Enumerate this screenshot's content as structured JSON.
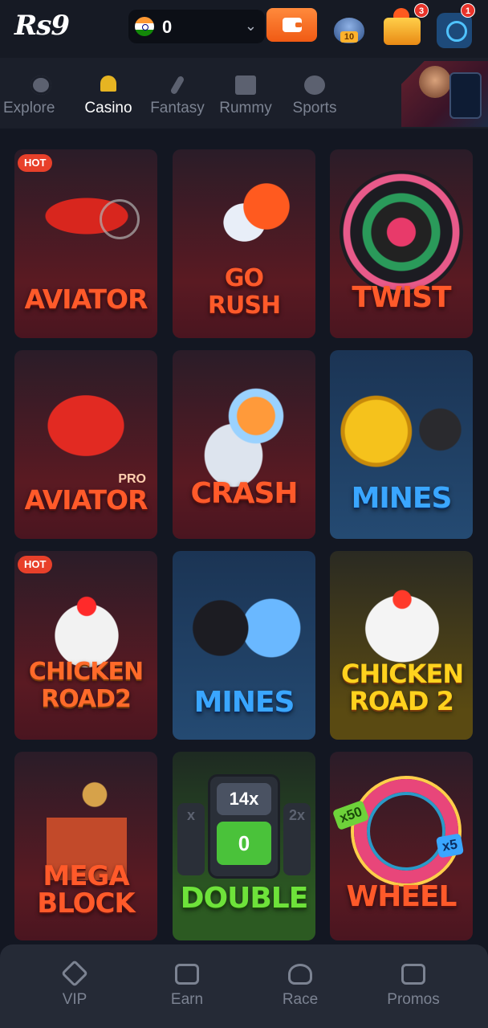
{
  "header": {
    "logo": "Rs9",
    "balance": "0",
    "pot_label": "10",
    "gift_badge": "3",
    "support_badge": "1"
  },
  "categories": [
    {
      "label": "Explore",
      "icon": "planet-icon",
      "active": false
    },
    {
      "label": "Casino",
      "icon": "spade-icon",
      "active": true
    },
    {
      "label": "Fantasy",
      "icon": "cricket-bat-icon",
      "active": false
    },
    {
      "label": "Rummy",
      "icon": "cards-icon",
      "active": false
    },
    {
      "label": "Sports",
      "icon": "football-icon",
      "active": false
    }
  ],
  "games": [
    {
      "title": "AVIATOR",
      "badge": "HOT"
    },
    {
      "title": "GO RUSH"
    },
    {
      "title": "TWIST"
    },
    {
      "title": "AVIATOR",
      "subtitle": "PRO"
    },
    {
      "title": "CRASH"
    },
    {
      "title": "MINES"
    },
    {
      "title": "CHICKEN ROAD2",
      "badge": "HOT"
    },
    {
      "title": "MINES"
    },
    {
      "title": "CHICKEN ROAD 2"
    },
    {
      "title": "MEGA BLOCK"
    },
    {
      "title": "DOUBLE",
      "multiplier": "14x",
      "value": "0",
      "side_left": "x",
      "side_right": "2x"
    },
    {
      "title": "WHEEL",
      "tag1": "x50",
      "tag2": "x5"
    }
  ],
  "bottom_nav": [
    {
      "label": "VIP",
      "icon": "diamond-icon"
    },
    {
      "label": "Earn",
      "icon": "earn-icon"
    },
    {
      "label": "Race",
      "icon": "trophy-icon"
    },
    {
      "label": "Promos",
      "icon": "gift-icon"
    }
  ],
  "colors": {
    "background": "#131722",
    "accent_orange": "#f05a14",
    "hot_badge": "#e8402a",
    "active_gold": "#e6b422"
  }
}
